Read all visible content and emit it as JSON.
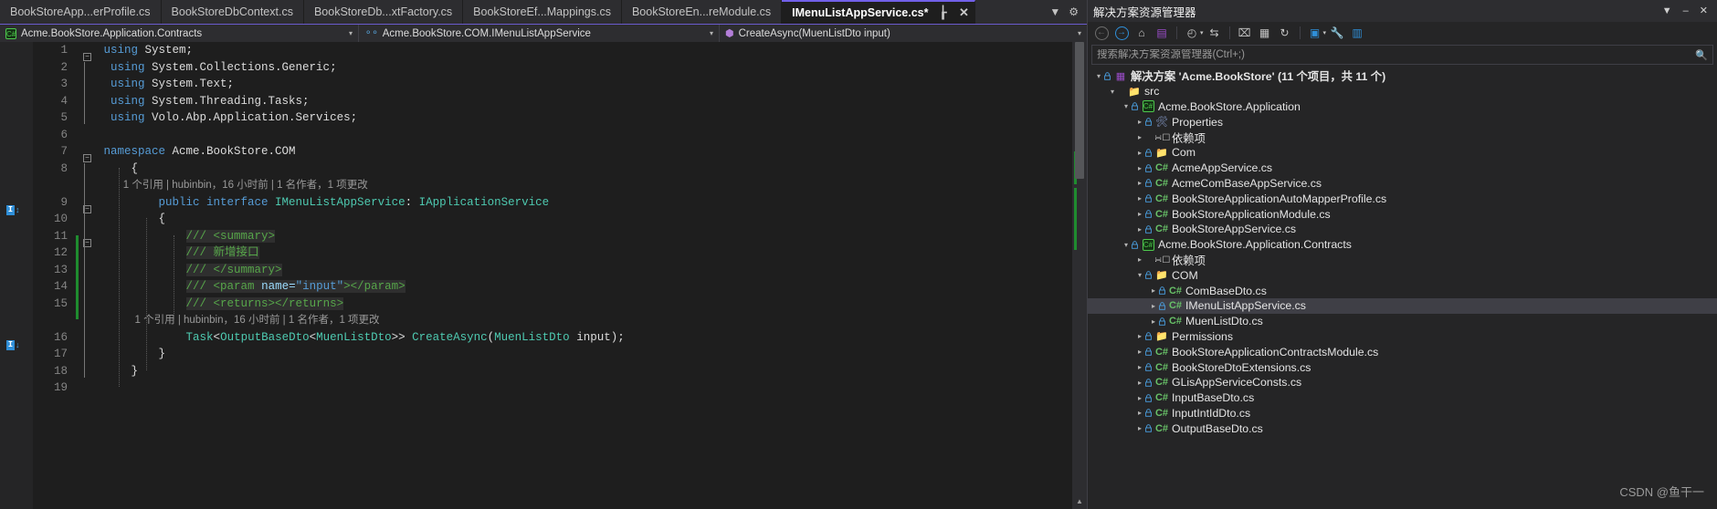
{
  "window": {
    "app": "Visual Studio",
    "accent_color": "#7160e8",
    "background": "#1e1e1e"
  },
  "tabs": {
    "items": [
      {
        "label": "BookStoreApp...erProfile.cs",
        "active": false,
        "modified": false
      },
      {
        "label": "BookStoreDbContext.cs",
        "active": false,
        "modified": false
      },
      {
        "label": "BookStoreDb...xtFactory.cs",
        "active": false,
        "modified": false
      },
      {
        "label": "BookStoreEf...Mappings.cs",
        "active": false,
        "modified": false
      },
      {
        "label": "BookStoreEn...reModule.cs",
        "active": false,
        "modified": false
      },
      {
        "label": "IMenuListAppService.cs*",
        "active": true,
        "modified": true
      }
    ],
    "close_glyph": "✕",
    "pin_glyph": "┟",
    "dropdown_glyph": "▼",
    "settings_glyph": "⚙"
  },
  "navbar": {
    "project": "Acme.BookStore.Application.Contracts",
    "project_icon": "csharp-project-icon",
    "type": "Acme.BookStore.COM.IMenuListAppService",
    "type_icon": "interface-icon",
    "member": "CreateAsync(MuenListDto input)",
    "member_icon": "method-icon",
    "caret": "▾"
  },
  "editor": {
    "lines": [
      {
        "num": 1,
        "type": "code",
        "indent": 0,
        "fold": "minus",
        "tokens": [
          {
            "t": "using ",
            "c": "blue"
          },
          {
            "t": "System;",
            "c": "plain"
          }
        ]
      },
      {
        "num": 2,
        "type": "code",
        "indent": 0,
        "tokens": [
          {
            "t": " using ",
            "c": "blue"
          },
          {
            "t": "System.Collections.Generic;",
            "c": "plain"
          }
        ]
      },
      {
        "num": 3,
        "type": "code",
        "indent": 0,
        "tokens": [
          {
            "t": " using ",
            "c": "blue"
          },
          {
            "t": "System.Text;",
            "c": "plain"
          }
        ]
      },
      {
        "num": 4,
        "type": "code",
        "indent": 0,
        "tokens": [
          {
            "t": " using ",
            "c": "blue"
          },
          {
            "t": "System.Threading.Tasks;",
            "c": "plain"
          }
        ]
      },
      {
        "num": 5,
        "type": "code",
        "indent": 0,
        "tokens": [
          {
            "t": " using ",
            "c": "blue"
          },
          {
            "t": "Volo.Abp.Application.Services;",
            "c": "plain"
          }
        ]
      },
      {
        "num": 6,
        "type": "code",
        "indent": 0,
        "tokens": []
      },
      {
        "num": 7,
        "type": "code",
        "indent": 0,
        "fold": "minus",
        "tokens": [
          {
            "t": "namespace ",
            "c": "blue"
          },
          {
            "t": "Acme.BookStore.COM",
            "c": "plain"
          }
        ]
      },
      {
        "num": 8,
        "type": "code",
        "indent": 1,
        "tokens": [
          {
            "t": "{",
            "c": "plain"
          }
        ]
      },
      {
        "num": null,
        "type": "codelens",
        "indent": 2,
        "text": "1 个引用 | hubinbin，16 小时前 | 1 名作者，1 项更改"
      },
      {
        "num": 9,
        "type": "code",
        "indent": 2,
        "fold": "minus",
        "tokens": [
          {
            "t": "public interface ",
            "c": "blue"
          },
          {
            "t": "IMenuListAppService",
            "c": "type"
          },
          {
            "t": ": ",
            "c": "plain"
          },
          {
            "t": "IApplicationService",
            "c": "type"
          }
        ]
      },
      {
        "num": 10,
        "type": "code",
        "indent": 2,
        "tokens": [
          {
            "t": "{",
            "c": "plain"
          }
        ]
      },
      {
        "num": 11,
        "type": "code",
        "indent": 3,
        "fold": "minus",
        "hl": true,
        "tokens": [
          {
            "t": "/// ",
            "c": "green"
          },
          {
            "t": "<summary>",
            "c": "green"
          }
        ]
      },
      {
        "num": 12,
        "type": "code",
        "indent": 3,
        "hl": true,
        "tokens": [
          {
            "t": "/// ",
            "c": "green"
          },
          {
            "t": "新增接口",
            "c": "green"
          }
        ]
      },
      {
        "num": 13,
        "type": "code",
        "indent": 3,
        "hl": true,
        "tokens": [
          {
            "t": "/// ",
            "c": "green"
          },
          {
            "t": "</summary>",
            "c": "green"
          }
        ]
      },
      {
        "num": 14,
        "type": "code",
        "indent": 3,
        "hl": true,
        "tokens": [
          {
            "t": "/// ",
            "c": "green"
          },
          {
            "t": "<param ",
            "c": "green"
          },
          {
            "t": "name=",
            "c": "param"
          },
          {
            "t": "\"input\"",
            "c": "str"
          },
          {
            "t": "></param>",
            "c": "green"
          }
        ]
      },
      {
        "num": 15,
        "type": "code",
        "indent": 3,
        "hl": true,
        "tokens": [
          {
            "t": "/// ",
            "c": "green"
          },
          {
            "t": "<returns></returns>",
            "c": "green"
          }
        ]
      },
      {
        "num": null,
        "type": "codelens",
        "indent": 3,
        "text": "1 个引用 | hubinbin，16 小时前 | 1 名作者，1 项更改"
      },
      {
        "num": 16,
        "type": "code",
        "indent": 3,
        "tokens": [
          {
            "t": "Task",
            "c": "type"
          },
          {
            "t": "<",
            "c": "plain"
          },
          {
            "t": "OutputBaseDto",
            "c": "type"
          },
          {
            "t": "<",
            "c": "plain"
          },
          {
            "t": "MuenListDto",
            "c": "type"
          },
          {
            "t": ">> ",
            "c": "plain"
          },
          {
            "t": "CreateAsync",
            "c": "type"
          },
          {
            "t": "(",
            "c": "plain"
          },
          {
            "t": "MuenListDto",
            "c": "type"
          },
          {
            "t": " input);",
            "c": "plain"
          }
        ]
      },
      {
        "num": 17,
        "type": "code",
        "indent": 2,
        "tokens": [
          {
            "t": "}",
            "c": "plain"
          }
        ]
      },
      {
        "num": 18,
        "type": "code",
        "indent": 1,
        "tokens": [
          {
            "t": "}",
            "c": "plain"
          }
        ]
      },
      {
        "num": 19,
        "type": "code",
        "indent": 0,
        "tokens": []
      }
    ],
    "codelens_markers": [
      {
        "line": 9,
        "glyph": "I",
        "arrow": "↕"
      },
      {
        "line": 16,
        "glyph": "I",
        "arrow": "↓"
      }
    ],
    "scrollbar": {
      "up_glyph": "▲"
    }
  },
  "solution_explorer": {
    "title": "解决方案资源管理器",
    "window_buttons": [
      {
        "name": "dropdown",
        "glyph": "▼"
      },
      {
        "name": "minimize",
        "glyph": "–"
      },
      {
        "name": "close",
        "glyph": "✕"
      }
    ],
    "toolbar": [
      {
        "name": "back-icon",
        "glyph": "←",
        "style": "dim"
      },
      {
        "name": "forward-icon",
        "glyph": "→",
        "style": "blue"
      },
      {
        "name": "home-icon",
        "glyph": "⌂",
        "style": ""
      },
      {
        "name": "pending-changes-icon",
        "glyph": "▤",
        "style": "purple"
      },
      {
        "name": "separator",
        "glyph": "",
        "style": "sep"
      },
      {
        "name": "history-icon",
        "glyph": "◴",
        "style": ""
      },
      {
        "name": "history-caret-icon",
        "glyph": "▾",
        "style": "caret"
      },
      {
        "name": "sync-icon",
        "glyph": "⇆",
        "style": ""
      },
      {
        "name": "separator",
        "glyph": "",
        "style": "sep"
      },
      {
        "name": "collapse-all-icon",
        "glyph": "⌧",
        "style": ""
      },
      {
        "name": "show-all-files-icon",
        "glyph": "▦",
        "style": ""
      },
      {
        "name": "refresh-icon",
        "glyph": "↻",
        "style": ""
      },
      {
        "name": "separator",
        "glyph": "",
        "style": "sep"
      },
      {
        "name": "view-icon",
        "glyph": "▣",
        "style": "blue"
      },
      {
        "name": "view-caret-icon",
        "glyph": "▾",
        "style": "caret"
      },
      {
        "name": "properties-icon",
        "glyph": "🔧",
        "style": "blue"
      },
      {
        "name": "preview-icon",
        "glyph": "▥",
        "style": "blue"
      }
    ],
    "search": {
      "placeholder": "搜索解决方案资源管理器(Ctrl+;)",
      "value": "",
      "icon": "search-icon"
    },
    "tree": [
      {
        "depth": 0,
        "expander": "▾",
        "lock": true,
        "icon": "solution-icon",
        "label": "解决方案 'Acme.BookStore' (11 个项目，共 11 个)",
        "bold": true,
        "selected": false
      },
      {
        "depth": 1,
        "expander": "▾",
        "lock": false,
        "icon": "folder-icon",
        "label": "src",
        "bold": false,
        "selected": false
      },
      {
        "depth": 2,
        "expander": "▾",
        "lock": true,
        "icon": "csproj-icon",
        "label": "Acme.BookStore.Application",
        "bold": false,
        "selected": false
      },
      {
        "depth": 3,
        "expander": "▸",
        "lock": true,
        "icon": "properties-icon",
        "label": "Properties",
        "bold": false,
        "selected": false
      },
      {
        "depth": 3,
        "expander": "▸",
        "lock": false,
        "icon": "dependencies-icon",
        "label": "依赖项",
        "bold": false,
        "selected": false
      },
      {
        "depth": 3,
        "expander": "▸",
        "lock": true,
        "icon": "folder-icon",
        "label": "Com",
        "bold": false,
        "selected": false
      },
      {
        "depth": 3,
        "expander": "▸",
        "lock": true,
        "icon": "csharp-icon",
        "label": "AcmeAppService.cs",
        "bold": false,
        "selected": false
      },
      {
        "depth": 3,
        "expander": "▸",
        "lock": true,
        "icon": "csharp-icon",
        "label": "AcmeComBaseAppService.cs",
        "bold": false,
        "selected": false
      },
      {
        "depth": 3,
        "expander": "▸",
        "lock": true,
        "icon": "csharp-icon",
        "label": "BookStoreApplicationAutoMapperProfile.cs",
        "bold": false,
        "selected": false
      },
      {
        "depth": 3,
        "expander": "▸",
        "lock": true,
        "icon": "csharp-icon",
        "label": "BookStoreApplicationModule.cs",
        "bold": false,
        "selected": false
      },
      {
        "depth": 3,
        "expander": "▸",
        "lock": true,
        "icon": "csharp-icon",
        "label": "BookStoreAppService.cs",
        "bold": false,
        "selected": false
      },
      {
        "depth": 2,
        "expander": "▾",
        "lock": true,
        "icon": "csproj-icon",
        "label": "Acme.BookStore.Application.Contracts",
        "bold": false,
        "selected": false
      },
      {
        "depth": 3,
        "expander": "▸",
        "lock": false,
        "icon": "dependencies-icon",
        "label": "依赖项",
        "bold": false,
        "selected": false
      },
      {
        "depth": 3,
        "expander": "▾",
        "lock": true,
        "icon": "folder-icon",
        "label": "COM",
        "bold": false,
        "selected": false
      },
      {
        "depth": 4,
        "expander": "▸",
        "lock": true,
        "icon": "csharp-icon",
        "label": "ComBaseDto.cs",
        "bold": false,
        "selected": false
      },
      {
        "depth": 4,
        "expander": "▸",
        "lock": true,
        "icon": "csharp-icon",
        "label": "IMenuListAppService.cs",
        "bold": false,
        "selected": true
      },
      {
        "depth": 4,
        "expander": "▸",
        "lock": true,
        "icon": "csharp-icon",
        "label": "MuenListDto.cs",
        "bold": false,
        "selected": false
      },
      {
        "depth": 3,
        "expander": "▸",
        "lock": true,
        "icon": "folder-icon",
        "label": "Permissions",
        "bold": false,
        "selected": false
      },
      {
        "depth": 3,
        "expander": "▸",
        "lock": true,
        "icon": "csharp-icon",
        "label": "BookStoreApplicationContractsModule.cs",
        "bold": false,
        "selected": false
      },
      {
        "depth": 3,
        "expander": "▸",
        "lock": true,
        "icon": "csharp-icon",
        "label": "BookStoreDtoExtensions.cs",
        "bold": false,
        "selected": false
      },
      {
        "depth": 3,
        "expander": "▸",
        "lock": true,
        "icon": "csharp-icon",
        "label": "GLisAppServiceConsts.cs",
        "bold": false,
        "selected": false
      },
      {
        "depth": 3,
        "expander": "▸",
        "lock": true,
        "icon": "csharp-icon",
        "label": "InputBaseDto.cs",
        "bold": false,
        "selected": false
      },
      {
        "depth": 3,
        "expander": "▸",
        "lock": true,
        "icon": "csharp-icon",
        "label": "InputIntIdDto.cs",
        "bold": false,
        "selected": false
      },
      {
        "depth": 3,
        "expander": "▸",
        "lock": true,
        "icon": "csharp-icon",
        "label": "OutputBaseDto.cs",
        "bold": false,
        "selected": false
      }
    ],
    "watermark": "CSDN @鱼干一"
  }
}
